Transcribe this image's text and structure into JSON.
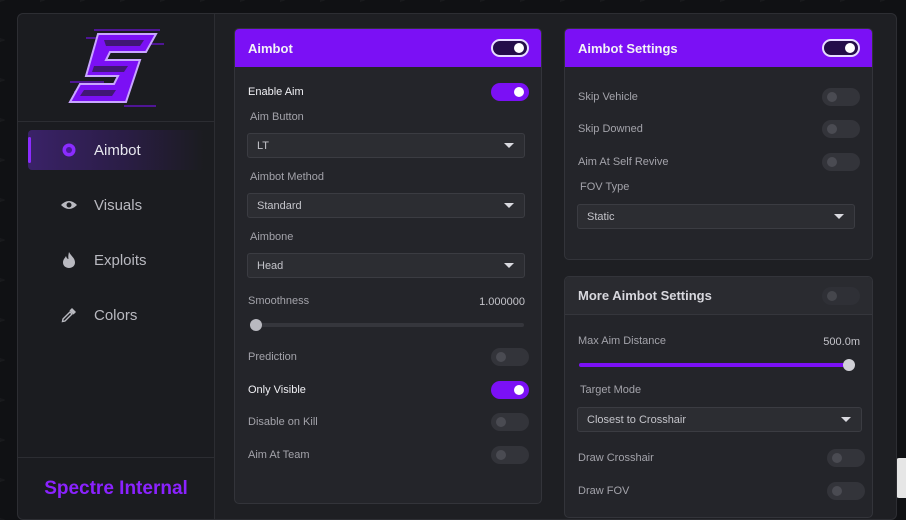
{
  "brand": {
    "name": "Spectre Internal",
    "color": "#8b22ff",
    "logo_letter": "S"
  },
  "sidebar": {
    "items": [
      {
        "label": "Aimbot",
        "icon": "circle-icon",
        "active": true
      },
      {
        "label": "Visuals",
        "icon": "eye-icon",
        "active": false
      },
      {
        "label": "Exploits",
        "icon": "flame-icon",
        "active": false
      },
      {
        "label": "Colors",
        "icon": "eyedropper-icon",
        "active": false
      }
    ]
  },
  "aimbot": {
    "title": "Aimbot",
    "enabled": true,
    "enable_aim": {
      "label": "Enable Aim",
      "on": true
    },
    "aim_button": {
      "label": "Aim Button",
      "value": "LT"
    },
    "aimbot_method": {
      "label": "Aimbot Method",
      "value": "Standard"
    },
    "aimbone": {
      "label": "Aimbone",
      "value": "Head"
    },
    "smoothness": {
      "label": "Smoothness",
      "display": "1.000000",
      "fraction": 0.0
    },
    "prediction": {
      "label": "Prediction",
      "on": false
    },
    "only_visible": {
      "label": "Only Visible",
      "on": true
    },
    "disable_on_kill": {
      "label": "Disable on Kill",
      "on": false
    },
    "aim_at_team": {
      "label": "Aim At Team",
      "on": false
    }
  },
  "aimbot_settings": {
    "title": "Aimbot Settings",
    "enabled": true,
    "skip_vehicle": {
      "label": "Skip Vehicle",
      "on": false
    },
    "skip_downed": {
      "label": "Skip Downed",
      "on": false
    },
    "aim_self_revive": {
      "label": "Aim At Self Revive",
      "on": false
    },
    "fov_type": {
      "label": "FOV Type",
      "value": "Static"
    }
  },
  "more_settings": {
    "title": "More Aimbot Settings",
    "enabled": false,
    "max_distance": {
      "label": "Max Aim Distance",
      "display": "500.0m",
      "fraction": 1.0
    },
    "target_mode": {
      "label": "Target Mode",
      "value": "Closest to Crosshair"
    },
    "draw_crosshair": {
      "label": "Draw Crosshair",
      "on": false
    },
    "draw_fov": {
      "label": "Draw FOV",
      "on": false
    }
  },
  "colors": {
    "accent": "#7b10f5",
    "panel": "#24252a",
    "sidebar": "#1b1c20"
  }
}
